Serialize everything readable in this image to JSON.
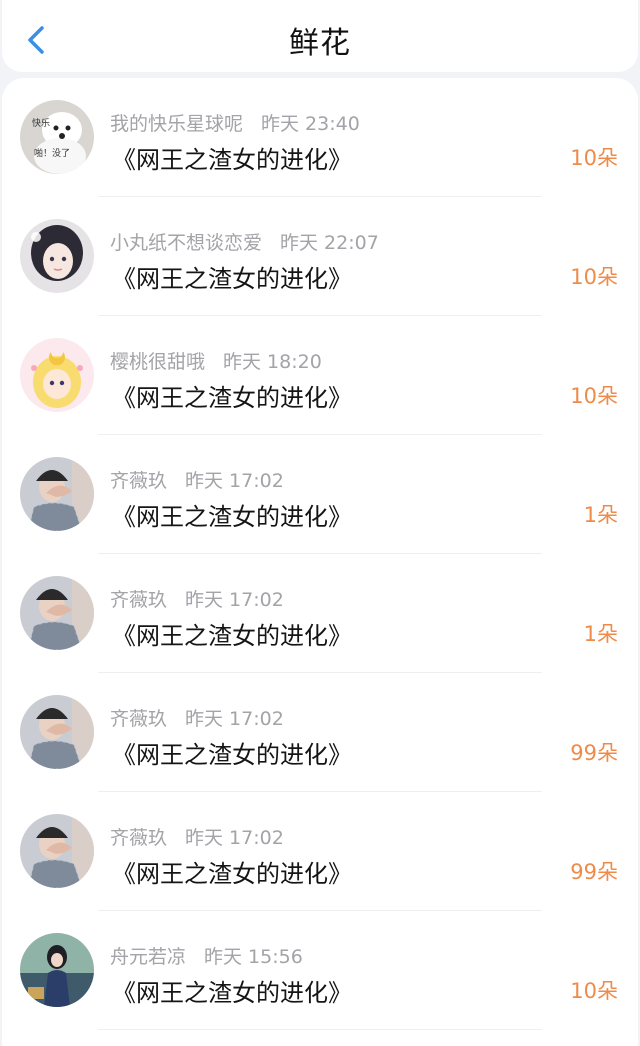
{
  "header": {
    "title": "鲜花"
  },
  "items": [
    {
      "user": "我的快乐星球呢",
      "time": "昨天 23:40",
      "book": "《网王之渣女的进化》",
      "amount": "10朵",
      "avatar": "white-dog-avatar"
    },
    {
      "user": "小丸纸不想谈恋爱",
      "time": "昨天 22:07",
      "book": "《网王之渣女的进化》",
      "amount": "10朵",
      "avatar": "anime-girl-avatar"
    },
    {
      "user": "樱桃很甜哦",
      "time": "昨天 18:20",
      "book": "《网王之渣女的进化》",
      "amount": "10朵",
      "avatar": "sailor-moon-avatar"
    },
    {
      "user": "齐薇玖",
      "time": "昨天 17:02",
      "book": "《网王之渣女的进化》",
      "amount": "1朵",
      "avatar": "heart-hands-avatar"
    },
    {
      "user": "齐薇玖",
      "time": "昨天 17:02",
      "book": "《网王之渣女的进化》",
      "amount": "1朵",
      "avatar": "heart-hands-avatar"
    },
    {
      "user": "齐薇玖",
      "time": "昨天 17:02",
      "book": "《网王之渣女的进化》",
      "amount": "99朵",
      "avatar": "heart-hands-avatar"
    },
    {
      "user": "齐薇玖",
      "time": "昨天 17:02",
      "book": "《网王之渣女的进化》",
      "amount": "99朵",
      "avatar": "heart-hands-avatar"
    },
    {
      "user": "舟元若凉",
      "time": "昨天 15:56",
      "book": "《网王之渣女的进化》",
      "amount": "10朵",
      "avatar": "girl-illustration-avatar"
    }
  ],
  "colors": {
    "accent": "#ef8b49",
    "back": "#3a8ee6"
  }
}
